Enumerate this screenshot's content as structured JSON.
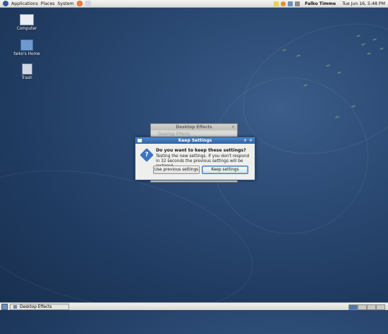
{
  "top_panel": {
    "menus": [
      "Applications",
      "Places",
      "System"
    ],
    "user_name": "Falko Timme",
    "clock": "Tue Jun 16,  5:48 PM"
  },
  "desktop": {
    "icons": [
      {
        "label": "Computer"
      },
      {
        "label": "falko's Home"
      },
      {
        "label": "Trash"
      }
    ]
  },
  "background_window": {
    "title": "Desktop Effects",
    "content": "Desktop Effects"
  },
  "dialog": {
    "title": "Keep Settings",
    "heading": "Do you want to keep these settings?",
    "body": "Testing the new settings. If you don't respond in 32 seconds the previous settings will be restored.",
    "button_previous": "Use previous settings",
    "button_keep": "Keep settings"
  },
  "taskbar": {
    "task_label": "Desktop Effects"
  },
  "colors": {
    "desktop_bg": "#22406a",
    "dialog_title": "#3a70b4"
  }
}
